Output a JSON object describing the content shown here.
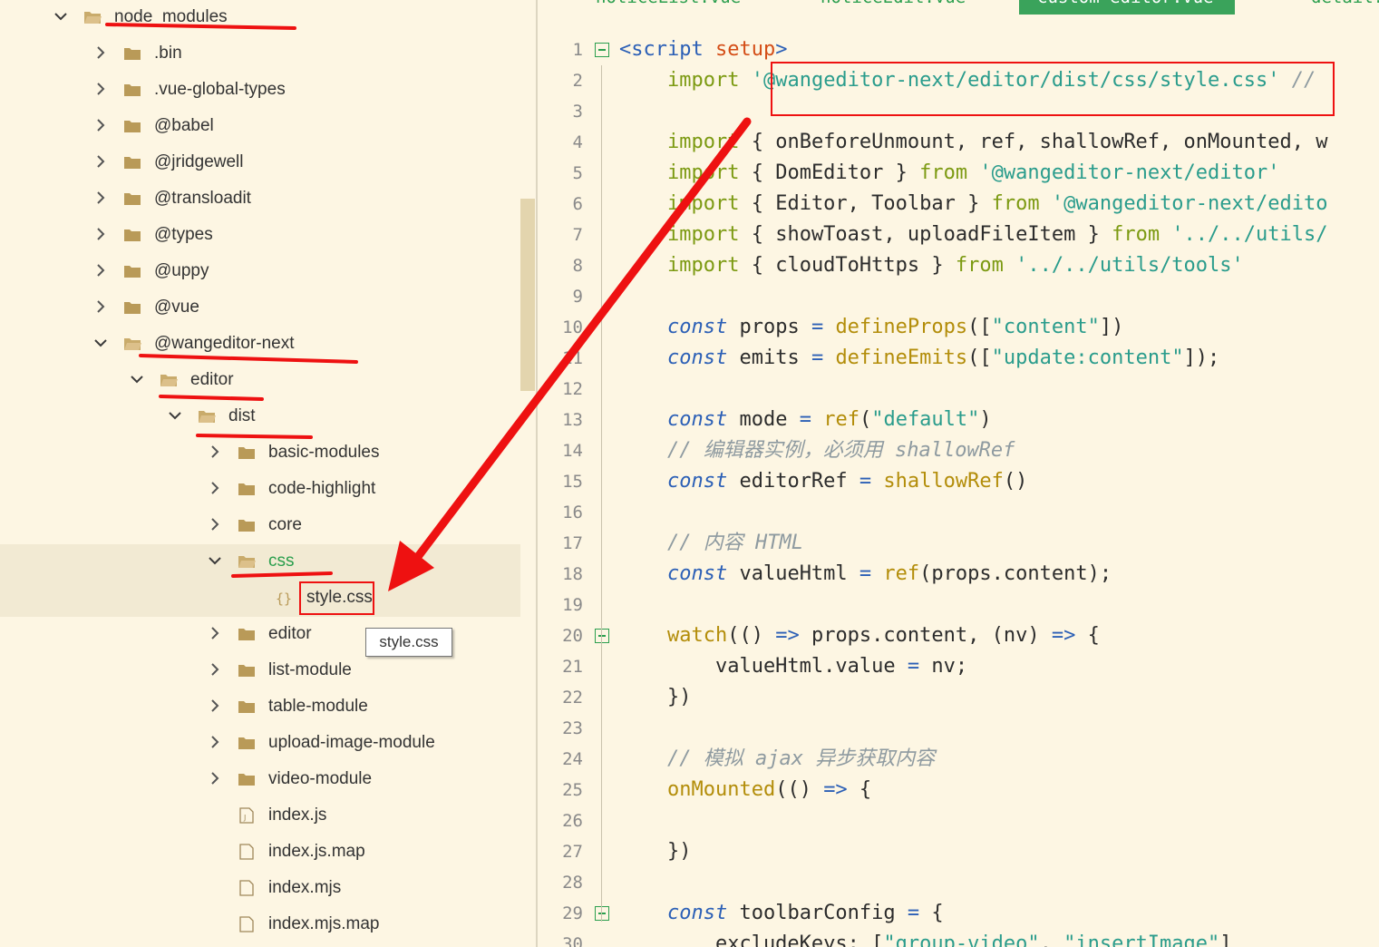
{
  "file_tree": {
    "items": [
      {
        "label": "node_modules",
        "depth": 0,
        "expanded": true,
        "kind": "folder"
      },
      {
        "label": ".bin",
        "depth": 1,
        "expanded": false,
        "kind": "folder"
      },
      {
        "label": ".vue-global-types",
        "depth": 1,
        "expanded": false,
        "kind": "folder"
      },
      {
        "label": "@babel",
        "depth": 1,
        "expanded": false,
        "kind": "folder"
      },
      {
        "label": "@jridgewell",
        "depth": 1,
        "expanded": false,
        "kind": "folder"
      },
      {
        "label": "@transloadit",
        "depth": 1,
        "expanded": false,
        "kind": "folder"
      },
      {
        "label": "@types",
        "depth": 1,
        "expanded": false,
        "kind": "folder"
      },
      {
        "label": "@uppy",
        "depth": 1,
        "expanded": false,
        "kind": "folder"
      },
      {
        "label": "@vue",
        "depth": 1,
        "expanded": false,
        "kind": "folder"
      },
      {
        "label": "@wangeditor-next",
        "depth": 1,
        "expanded": true,
        "kind": "folder"
      },
      {
        "label": "editor",
        "depth": 2,
        "expanded": true,
        "kind": "folder"
      },
      {
        "label": "dist",
        "depth": 3,
        "expanded": true,
        "kind": "folder"
      },
      {
        "label": "basic-modules",
        "depth": 4,
        "expanded": false,
        "kind": "folder"
      },
      {
        "label": "code-highlight",
        "depth": 4,
        "expanded": false,
        "kind": "folder"
      },
      {
        "label": "core",
        "depth": 4,
        "expanded": false,
        "kind": "folder"
      },
      {
        "label": "css",
        "depth": 4,
        "expanded": true,
        "kind": "folder",
        "highlight": true
      },
      {
        "label": "style.css",
        "depth": 5,
        "expanded": false,
        "kind": "css-file"
      },
      {
        "label": "editor",
        "depth": 4,
        "expanded": false,
        "kind": "folder"
      },
      {
        "label": "list-module",
        "depth": 4,
        "expanded": false,
        "kind": "folder"
      },
      {
        "label": "table-module",
        "depth": 4,
        "expanded": false,
        "kind": "folder"
      },
      {
        "label": "upload-image-module",
        "depth": 4,
        "expanded": false,
        "kind": "folder"
      },
      {
        "label": "video-module",
        "depth": 4,
        "expanded": false,
        "kind": "folder"
      },
      {
        "label": "index.js",
        "depth": 4,
        "expanded": false,
        "kind": "js-file"
      },
      {
        "label": "index.js.map",
        "depth": 4,
        "expanded": false,
        "kind": "file"
      },
      {
        "label": "index.mjs",
        "depth": 4,
        "expanded": false,
        "kind": "file"
      },
      {
        "label": "index.mjs.map",
        "depth": 4,
        "expanded": false,
        "kind": "file"
      }
    ],
    "tooltip": "style.css"
  },
  "tabs": [
    {
      "label": "noticeList.vue",
      "active": false
    },
    {
      "label": "noticeEdit.vue",
      "active": false
    },
    {
      "label": "custom-editor.vue",
      "active": true
    },
    {
      "label": "detail.vue",
      "active": false
    }
  ],
  "code_lines": [
    [
      [
        "tag",
        "<script "
      ],
      [
        "attr",
        "setup"
      ],
      [
        "tag",
        ">"
      ]
    ],
    [
      [
        "",
        "    "
      ],
      [
        "kw",
        "import"
      ],
      [
        "",
        " "
      ],
      [
        "str",
        "'@wangeditor-next/editor/dist/css/style.css'"
      ],
      [
        "",
        " "
      ],
      [
        "cm",
        "//"
      ]
    ],
    [],
    [
      [
        "",
        "    "
      ],
      [
        "kw",
        "import"
      ],
      [
        "",
        " { onBeforeUnmount, ref, shallowRef, onMounted, w"
      ]
    ],
    [
      [
        "",
        "    "
      ],
      [
        "kw",
        "import"
      ],
      [
        "",
        " { DomEditor } "
      ],
      [
        "kw",
        "from"
      ],
      [
        "",
        " "
      ],
      [
        "str",
        "'@wangeditor-next/editor'"
      ]
    ],
    [
      [
        "",
        "    "
      ],
      [
        "kw",
        "import"
      ],
      [
        "",
        " { Editor, Toolbar } "
      ],
      [
        "kw",
        "from"
      ],
      [
        "",
        " "
      ],
      [
        "str",
        "'@wangeditor-next/edito"
      ]
    ],
    [
      [
        "",
        "    "
      ],
      [
        "kw",
        "import"
      ],
      [
        "",
        " { showToast, uploadFileItem } "
      ],
      [
        "kw",
        "from"
      ],
      [
        "",
        " "
      ],
      [
        "str",
        "'../../utils/"
      ]
    ],
    [
      [
        "",
        "    "
      ],
      [
        "kw",
        "import"
      ],
      [
        "",
        " { cloudToHttps } "
      ],
      [
        "kw",
        "from"
      ],
      [
        "",
        " "
      ],
      [
        "str",
        "'../../utils/tools'"
      ]
    ],
    [],
    [
      [
        "",
        "    "
      ],
      [
        "kw2",
        "const"
      ],
      [
        "",
        " props "
      ],
      [
        "op",
        "="
      ],
      [
        "",
        " "
      ],
      [
        "fn",
        "defineProps"
      ],
      [
        "",
        "(["
      ],
      [
        "str",
        "\"content\""
      ],
      [
        "",
        "])"
      ]
    ],
    [
      [
        "",
        "    "
      ],
      [
        "kw2",
        "const"
      ],
      [
        "",
        " emits "
      ],
      [
        "op",
        "="
      ],
      [
        "",
        " "
      ],
      [
        "fn",
        "defineEmits"
      ],
      [
        "",
        "(["
      ],
      [
        "str",
        "\"update:content\""
      ],
      [
        "",
        "]);"
      ]
    ],
    [],
    [
      [
        "",
        "    "
      ],
      [
        "kw2",
        "const"
      ],
      [
        "",
        " mode "
      ],
      [
        "op",
        "="
      ],
      [
        "",
        " "
      ],
      [
        "fn",
        "ref"
      ],
      [
        "",
        "("
      ],
      [
        "str",
        "\"default\""
      ],
      [
        "",
        ")"
      ]
    ],
    [
      [
        "",
        "    "
      ],
      [
        "cm",
        "// 编辑器实例，必须用 shallowRef"
      ]
    ],
    [
      [
        "",
        "    "
      ],
      [
        "kw2",
        "const"
      ],
      [
        "",
        " editorRef "
      ],
      [
        "op",
        "="
      ],
      [
        "",
        " "
      ],
      [
        "fn",
        "shallowRef"
      ],
      [
        "",
        "()"
      ]
    ],
    [],
    [
      [
        "",
        "    "
      ],
      [
        "cm",
        "// 内容 HTML"
      ]
    ],
    [
      [
        "",
        "    "
      ],
      [
        "kw2",
        "const"
      ],
      [
        "",
        " valueHtml "
      ],
      [
        "op",
        "="
      ],
      [
        "",
        " "
      ],
      [
        "fn",
        "ref"
      ],
      [
        "",
        "(props.content);"
      ]
    ],
    [],
    [
      [
        "",
        "    "
      ],
      [
        "fn",
        "watch"
      ],
      [
        "",
        "(() "
      ],
      [
        "op",
        "=>"
      ],
      [
        "",
        " props.content, (nv) "
      ],
      [
        "op",
        "=>"
      ],
      [
        "",
        " {"
      ]
    ],
    [
      [
        "",
        "        valueHtml.value "
      ],
      [
        "op",
        "="
      ],
      [
        "",
        " nv;"
      ]
    ],
    [
      [
        "",
        "    })"
      ]
    ],
    [],
    [
      [
        "",
        "    "
      ],
      [
        "cm",
        "// 模拟 ajax 异步获取内容"
      ]
    ],
    [
      [
        "",
        "    "
      ],
      [
        "fn",
        "onMounted"
      ],
      [
        "",
        "(() "
      ],
      [
        "op",
        "=>"
      ],
      [
        "",
        " {"
      ]
    ],
    [],
    [
      [
        "",
        "    })"
      ]
    ],
    [],
    [
      [
        "",
        "    "
      ],
      [
        "kw2",
        "const"
      ],
      [
        "",
        " toolbarConfig "
      ],
      [
        "op",
        "="
      ],
      [
        "",
        " {"
      ]
    ],
    [
      [
        "",
        "        excludeKeys: ["
      ],
      [
        "str",
        "\"group-video\""
      ],
      [
        "",
        ", "
      ],
      [
        "str",
        "\"insertImage\""
      ],
      [
        "",
        "]"
      ]
    ]
  ],
  "fold_lines": [
    1,
    20,
    29
  ],
  "colors": {
    "annotation_red": "#ee1111",
    "accent_green": "#3aa35b",
    "background": "#fdf6e3"
  }
}
